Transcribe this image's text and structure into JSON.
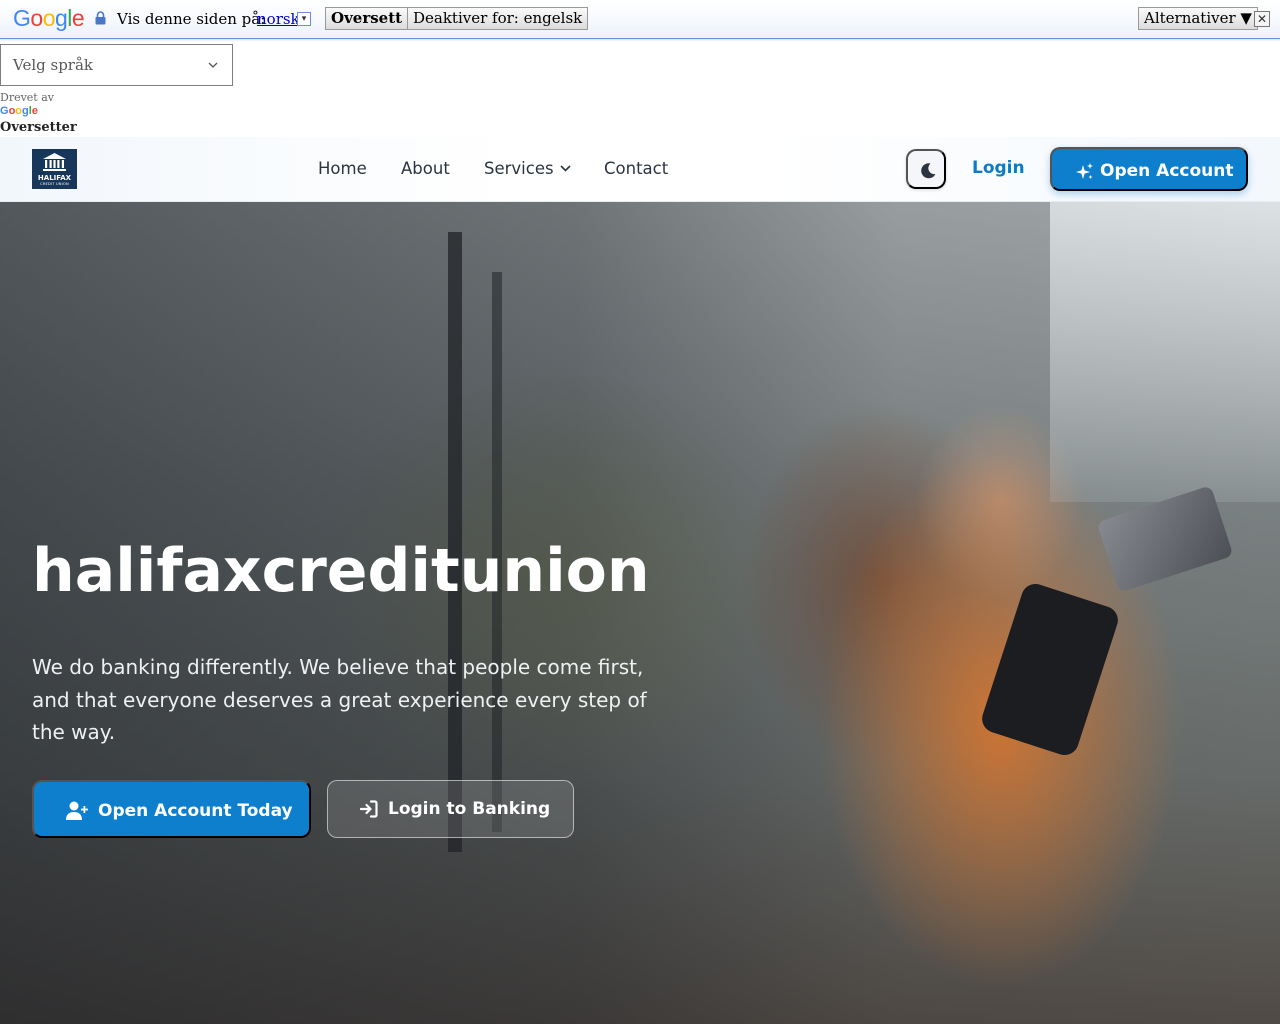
{
  "translate_bar": {
    "logo": {
      "g1": "G",
      "o1": "o",
      "o2": "o",
      "g2": "g",
      "l": "l",
      "e": "e"
    },
    "prompt": "Vis denne siden på:",
    "language": "norsk",
    "caret": "▾",
    "translate_button": "Oversett",
    "disable_button": "Deaktiver for: engelsk",
    "options_button": "Alternativer ▼",
    "close_glyph": "✕"
  },
  "translate_widget": {
    "select_placeholder": "Velg språk",
    "powered_by": "Drevet av",
    "powered_logo": {
      "g1": "G",
      "o1": "o",
      "o2": "o",
      "g2": "g",
      "l": "l",
      "e": "e"
    },
    "brand": "Oversetter"
  },
  "header": {
    "logo_name": "HALIFAX",
    "logo_tagline": "CREDIT UNION",
    "nav": [
      "Home",
      "About",
      "Services",
      "Contact"
    ],
    "login": "Login",
    "open_account": "Open Account"
  },
  "hero": {
    "title": "halifaxcreditunion",
    "subtitle": "We do banking differently. We believe that people come first, and that everyone deserves a great experience every step of the way.",
    "primary_button": "Open Account Today",
    "secondary_button": "Login to Banking"
  },
  "colors": {
    "accent": "#0d7fcc",
    "login_link": "#0e7bc6",
    "logo_bg": "#16365a"
  },
  "icons": [
    "lock-icon",
    "chevron-down-icon",
    "close-icon",
    "bank-building-icon",
    "moon-icon",
    "sparkles-icon",
    "user-plus-icon",
    "sign-in-icon"
  ]
}
